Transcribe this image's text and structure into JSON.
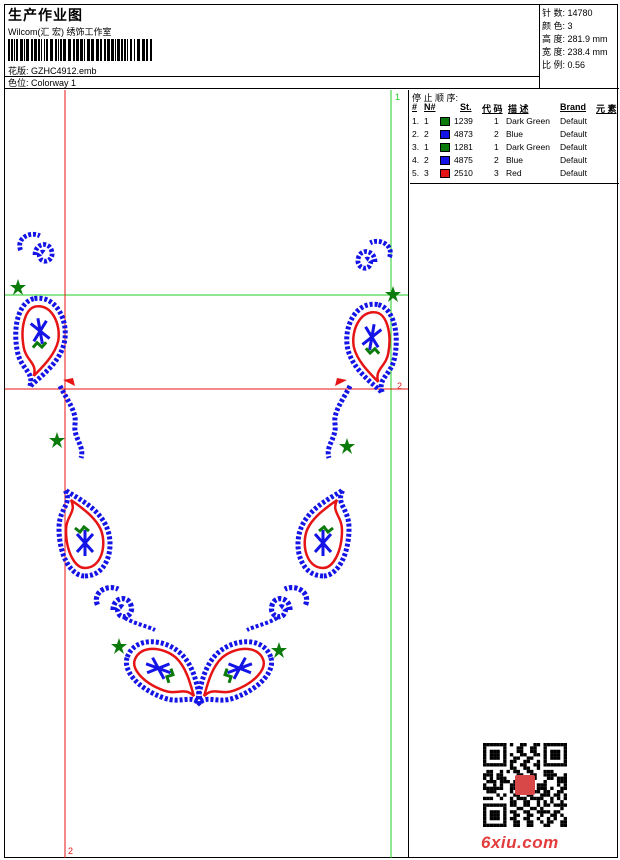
{
  "header": {
    "title": "生产作业图",
    "studio": "Wilcom(汇 宏) 绣饰工作室",
    "file_label": "花版:",
    "file_name": "GZHC4912.emb",
    "colorway_label": "色位:",
    "colorway": "Colorway 1"
  },
  "stats": [
    {
      "label": "针 数:",
      "value": "14780"
    },
    {
      "label": "颜 色:",
      "value": "3"
    },
    {
      "label": "高 度:",
      "value": "281.9 mm"
    },
    {
      "label": "宽 度:",
      "value": "238.4 mm"
    },
    {
      "label": "比 例:",
      "value": "0.56"
    }
  ],
  "stop_sequence": {
    "title": "停 止 顺 序:",
    "columns": {
      "idx": "#",
      "num": "N#",
      "st": "St.",
      "code": "代 码",
      "desc": "描 述",
      "brand": "Brand",
      "elem": "元 素"
    },
    "rows": [
      {
        "idx": "1.",
        "num": "1",
        "st": "1239",
        "code": "1",
        "desc": "Dark Green",
        "brand": "Default",
        "color": "#0a7a0a"
      },
      {
        "idx": "2.",
        "num": "2",
        "st": "4873",
        "code": "2",
        "desc": "Blue",
        "brand": "Default",
        "color": "#1414e6"
      },
      {
        "idx": "3.",
        "num": "1",
        "st": "1281",
        "code": "1",
        "desc": "Dark Green",
        "brand": "Default",
        "color": "#0a7a0a"
      },
      {
        "idx": "4.",
        "num": "2",
        "st": "4875",
        "code": "2",
        "desc": "Blue",
        "brand": "Default",
        "color": "#1414e6"
      },
      {
        "idx": "5.",
        "num": "3",
        "st": "2510",
        "code": "3",
        "desc": "Red",
        "brand": "Default",
        "color": "#e61414"
      }
    ]
  },
  "markers": {
    "top": "1",
    "right": "2",
    "bottom": "2"
  },
  "watermark": {
    "site": "6xiu.com"
  },
  "colors": {
    "blue": "#1414e6",
    "red": "#e61414",
    "green": "#0a7a0a",
    "guide_green": "#22cc22",
    "guide_red": "#e61414"
  }
}
